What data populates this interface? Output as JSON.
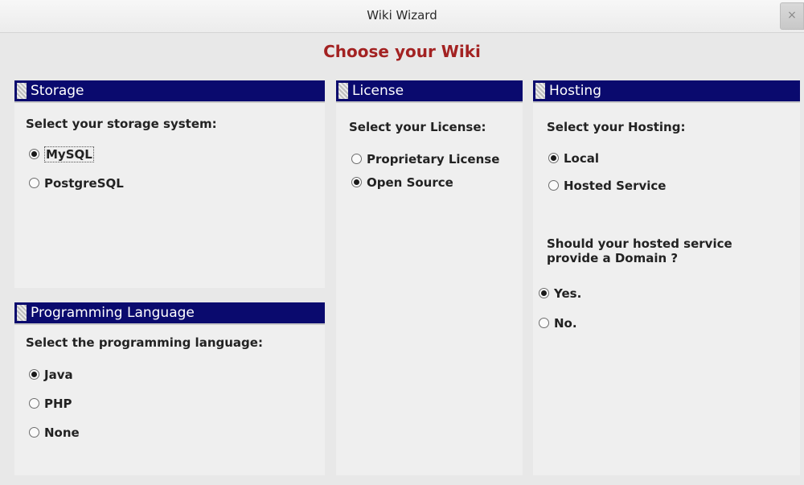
{
  "window": {
    "title": "Wiki Wizard",
    "close_glyph": "×"
  },
  "heading": "Choose your Wiki",
  "storage": {
    "header": "Storage",
    "prompt": "Select your storage system:",
    "options": [
      {
        "label": "MySQL",
        "checked": true
      },
      {
        "label": "PostgreSQL",
        "checked": false
      }
    ]
  },
  "language": {
    "header": "Programming Language",
    "prompt": "Select the programming language:",
    "options": [
      {
        "label": "Java",
        "checked": true
      },
      {
        "label": "PHP",
        "checked": false
      },
      {
        "label": "None",
        "checked": false
      }
    ]
  },
  "license": {
    "header": "License",
    "prompt": "Select your License:",
    "options": [
      {
        "label": "Proprietary License",
        "checked": false
      },
      {
        "label": "Open Source",
        "checked": true
      }
    ]
  },
  "hosting": {
    "header": "Hosting",
    "prompt": "Select your Hosting:",
    "options": [
      {
        "label": "Local",
        "checked": true
      },
      {
        "label": "Hosted Service",
        "checked": false
      }
    ],
    "domain_question": "Should your hosted service provide a Domain ?",
    "domain_options": [
      {
        "label": "Yes.",
        "checked": true
      },
      {
        "label": "No.",
        "checked": false
      }
    ]
  },
  "colors": {
    "header_bg": "#0a0a6e",
    "heading": "#a32222",
    "window_bg": "#e8e8e8"
  }
}
